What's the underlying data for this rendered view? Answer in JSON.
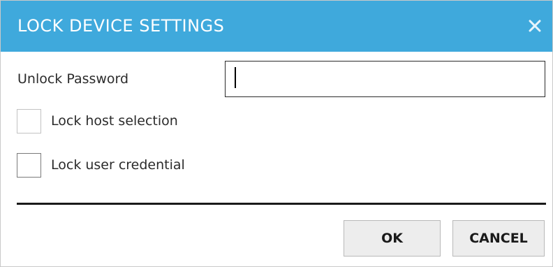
{
  "dialog": {
    "title": "LOCK DEVICE SETTINGS",
    "close_icon": "close-icon",
    "title_bar_color": "#3fa9dc"
  },
  "form": {
    "password_label": "Unlock Password",
    "password_value": "",
    "lock_host_selection": {
      "label": "Lock host selection",
      "checked": false
    },
    "lock_user_credential": {
      "label": "Lock user credential",
      "checked": false
    }
  },
  "buttons": {
    "ok_label": "OK",
    "cancel_label": "CANCEL"
  }
}
